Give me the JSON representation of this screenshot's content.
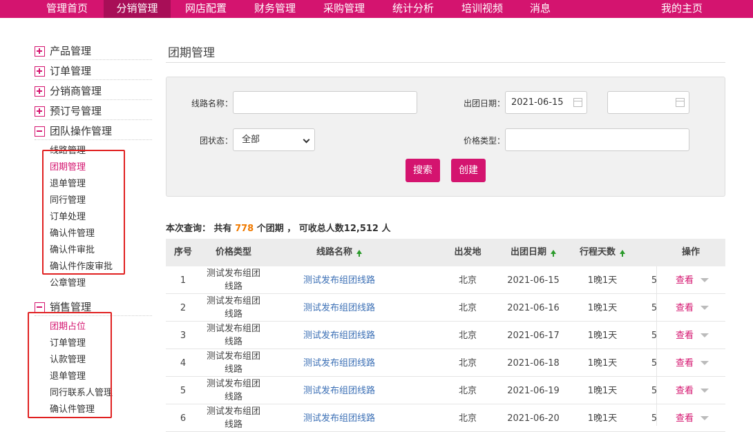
{
  "nav": {
    "items": [
      "管理首页",
      "分销管理",
      "网店配置",
      "财务管理",
      "采购管理",
      "统计分析",
      "培训视频",
      "消息"
    ],
    "active": "分销管理",
    "right": "我的主页"
  },
  "sidebar": {
    "groups": [
      {
        "label": "产品管理",
        "expanded": false
      },
      {
        "label": "订单管理",
        "expanded": false
      },
      {
        "label": "分销商管理",
        "expanded": false
      },
      {
        "label": "预订号管理",
        "expanded": false
      },
      {
        "label": "团队操作管理",
        "expanded": true
      },
      {
        "label": "销售管理",
        "expanded": true
      }
    ],
    "team_items": [
      "线路管理",
      "团期管理",
      "退单管理",
      "同行管理",
      "订单处理",
      "确认件管理",
      "确认件审批",
      "确认件作废审批",
      "公章管理"
    ],
    "team_active": "团期管理",
    "sales_items": [
      "团期占位",
      "订单管理",
      "认款管理",
      "退单管理",
      "同行联系人管理",
      "确认件管理"
    ],
    "sales_active": "团期占位"
  },
  "page_title": "团期管理",
  "search": {
    "route_name_label": "线路名称：",
    "route_name_value": "",
    "date_label": "出团日期：",
    "date_from": "2021-06-15",
    "date_to": "",
    "status_label": "团状态：",
    "status_value": "全部",
    "price_type_label": "价格类型：",
    "price_type_value": "",
    "search_button": "搜索",
    "create_button": "创建"
  },
  "summary": {
    "prefix": "本次查询： 共有",
    "count": "778",
    "middle": "个团期 ， 可收总人数12,512 人"
  },
  "table": {
    "headers": [
      "序号",
      "价格类型",
      "线路名称",
      "出发地",
      "出团日期",
      "行程天数",
      "操作"
    ],
    "rows": [
      {
        "no": "1",
        "price_type": "测试发布组团线路",
        "route": "测试发布组团线路",
        "origin": "北京",
        "date": "2021-06-15",
        "days": "1晚1天",
        "extra": "5",
        "action": "查看"
      },
      {
        "no": "2",
        "price_type": "测试发布组团线路",
        "route": "测试发布组团线路",
        "origin": "北京",
        "date": "2021-06-16",
        "days": "1晚1天",
        "extra": "5",
        "action": "查看"
      },
      {
        "no": "3",
        "price_type": "测试发布组团线路",
        "route": "测试发布组团线路",
        "origin": "北京",
        "date": "2021-06-17",
        "days": "1晚1天",
        "extra": "5",
        "action": "查看"
      },
      {
        "no": "4",
        "price_type": "测试发布组团线路",
        "route": "测试发布组团线路",
        "origin": "北京",
        "date": "2021-06-18",
        "days": "1晚1天",
        "extra": "5",
        "action": "查看"
      },
      {
        "no": "5",
        "price_type": "测试发布组团线路",
        "route": "测试发布组团线路",
        "origin": "北京",
        "date": "2021-06-19",
        "days": "1晚1天",
        "extra": "5",
        "action": "查看"
      },
      {
        "no": "6",
        "price_type": "测试发布组团线路",
        "route": "测试发布组团线路",
        "origin": "北京",
        "date": "2021-06-20",
        "days": "1晚1天",
        "extra": "5",
        "action": "查看"
      }
    ]
  },
  "colors": {
    "brand": "#d4146f",
    "highlight_box": "#e02020",
    "count": "#f07a00",
    "link": "#3b6fb5"
  }
}
